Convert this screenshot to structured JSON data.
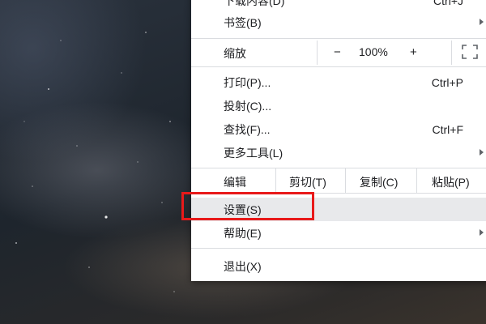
{
  "menu": {
    "partial_top_label": "下载内容(D)",
    "partial_top_shortcut": "Ctrl+J",
    "bookmarks_label": "书签(B)",
    "zoom": {
      "label": "缩放",
      "minus": "−",
      "value": "100%",
      "plus": "+"
    },
    "print": {
      "label": "打印(P)...",
      "shortcut": "Ctrl+P"
    },
    "cast": {
      "label": "投射(C)..."
    },
    "find": {
      "label": "查找(F)...",
      "shortcut": "Ctrl+F"
    },
    "more_tools": {
      "label": "更多工具(L)"
    },
    "edit": {
      "label": "编辑",
      "cut": "剪切(T)",
      "copy": "复制(C)",
      "paste": "粘贴(P)"
    },
    "settings": {
      "label": "设置(S)"
    },
    "help": {
      "label": "帮助(E)"
    },
    "exit": {
      "label": "退出(X)"
    }
  },
  "colors": {
    "highlight_box": "#e81a1a",
    "menu_background": "#ffffff",
    "separator": "#dadce0"
  }
}
